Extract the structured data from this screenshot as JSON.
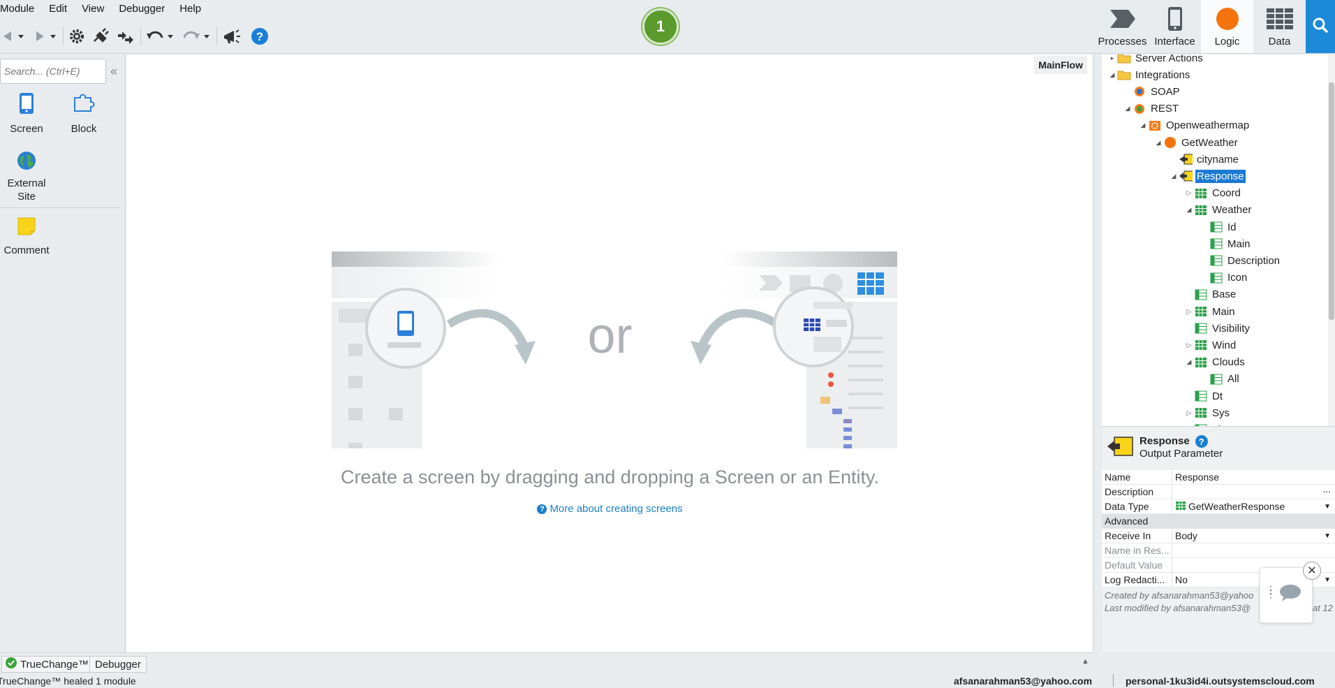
{
  "menu": [
    "Module",
    "Edit",
    "View",
    "Debugger",
    "Help"
  ],
  "publish_badge": "1",
  "tabs": [
    {
      "label": "Processes"
    },
    {
      "label": "Interface"
    },
    {
      "label": "Logic"
    },
    {
      "label": "Data"
    }
  ],
  "left": {
    "search_placeholder": "Search... (Ctrl+E)",
    "tools": [
      {
        "label": "Screen"
      },
      {
        "label": "Block"
      },
      {
        "label": "External\nSite"
      },
      {
        "label": "Comment"
      }
    ]
  },
  "canvas": {
    "flow": "MainFlow",
    "or_text": "or",
    "hint": "Create a screen by dragging and dropping a Screen or an Entity.",
    "more_link": "More about creating screens"
  },
  "tree": [
    {
      "label": "Server Actions",
      "icon": "folder-icon",
      "twisty": "▸"
    },
    {
      "label": "Integrations",
      "icon": "folder-icon",
      "twisty": "◢"
    },
    {
      "label": "SOAP",
      "icon": "soap-icon",
      "twisty": ""
    },
    {
      "label": "REST",
      "icon": "rest-icon",
      "twisty": "◢"
    },
    {
      "label": "Openweathermap",
      "icon": "api-icon",
      "twisty": "◢"
    },
    {
      "label": "GetWeather",
      "icon": "method-icon",
      "twisty": "◢"
    },
    {
      "label": "cityname",
      "icon": "input-param-icon",
      "twisty": ""
    },
    {
      "label": "Response",
      "icon": "output-param-icon",
      "twisty": "◢"
    },
    {
      "label": "Coord",
      "icon": "structure-icon",
      "twisty": "▷"
    },
    {
      "label": "Weather",
      "icon": "structure-icon",
      "twisty": "◢"
    },
    {
      "label": "Id",
      "icon": "attribute-icon",
      "twisty": ""
    },
    {
      "label": "Main",
      "icon": "attribute-icon",
      "twisty": ""
    },
    {
      "label": "Description",
      "icon": "attribute-icon",
      "twisty": ""
    },
    {
      "label": "Icon",
      "icon": "attribute-icon",
      "twisty": ""
    },
    {
      "label": "Base",
      "icon": "attribute-icon",
      "twisty": ""
    },
    {
      "label": "Main",
      "icon": "structure-icon",
      "twisty": "▷"
    },
    {
      "label": "Visibility",
      "icon": "attribute-icon",
      "twisty": ""
    },
    {
      "label": "Wind",
      "icon": "structure-icon",
      "twisty": "▷"
    },
    {
      "label": "Clouds",
      "icon": "structure-icon",
      "twisty": "◢"
    },
    {
      "label": "All",
      "icon": "attribute-icon",
      "twisty": ""
    },
    {
      "label": "Dt",
      "icon": "attribute-icon",
      "twisty": ""
    },
    {
      "label": "Sys",
      "icon": "structure-icon",
      "twisty": "▷"
    },
    {
      "label": "Timezone",
      "icon": "attribute-icon",
      "twisty": ""
    }
  ],
  "props": {
    "title": "Response",
    "subtitle": "Output Parameter",
    "rows": [
      {
        "key": "Name",
        "value": "Response"
      },
      {
        "key": "Description",
        "value": "..."
      },
      {
        "key": "Data Type",
        "value": "GetWeatherResponse"
      }
    ],
    "section": "Advanced",
    "adv_rows": [
      {
        "key": "Receive In",
        "value": "Body"
      },
      {
        "key": "Name in Res...",
        "value": ""
      },
      {
        "key": "Default Value",
        "value": ""
      },
      {
        "key": "Log Redacti...",
        "value": "No"
      }
    ],
    "created": "Created by afsanarahman53@yahoo",
    "modified": "Last modified by afsanarahman53@",
    "modified_tail": "at 12"
  },
  "bottom_tabs": [
    "TrueChange™",
    "Debugger"
  ],
  "status": {
    "message": "TrueChange™ healed 1 module",
    "user": "afsanarahman53@yahoo.com",
    "server": "personal-1ku3id4i.outsystemscloud.com"
  }
}
